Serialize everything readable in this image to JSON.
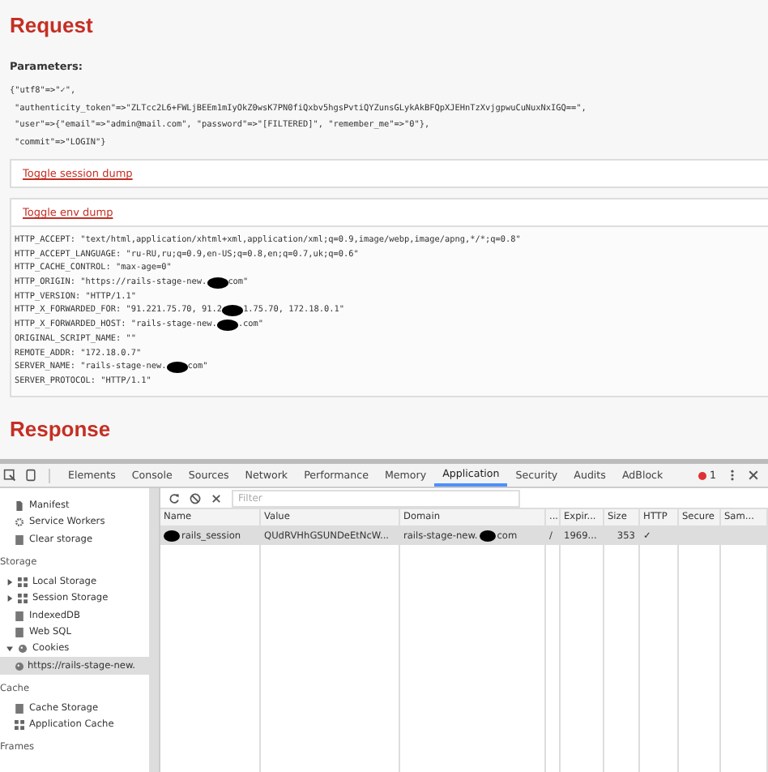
{
  "request": {
    "heading": "Request",
    "parameters_label": "Parameters:",
    "parameter_lines": [
      "{\"utf8\"=>\"✓\",",
      "\"authenticity_token\"=>\"ZLTcc2L6+FWLjBEEm1mIyOkZ0wsK7PN0fiQxbv5hgsPvtiQYZunsGLykAkBFQpXJEHnTzXvjgpwuCuNuxNxIGQ==\",",
      "\"user\"=>{\"email\"=>\"admin@mail.com\", \"password\"=>\"[FILTERED]\", \"remember_me\"=>\"0\"},",
      "\"commit\"=>\"LOGIN\"}"
    ],
    "session_toggle": "Toggle session dump",
    "env_toggle": "Toggle env dump",
    "env_lines": [
      [
        {
          "kind": "text",
          "text": "HTTP_ACCEPT: \"text/html,application/xhtml+xml,application/xml;q=0.9,image/webp,image/apng,*/*;q=0.8\""
        }
      ],
      [
        {
          "kind": "text",
          "text": "HTTP_ACCEPT_LANGUAGE: \"ru-RU,ru;q=0.9,en-US;q=0.8,en;q=0.7,uk;q=0.6\""
        }
      ],
      [
        {
          "kind": "text",
          "text": "HTTP_CACHE_CONTROL: \"max-age=0\""
        }
      ],
      [
        {
          "kind": "text",
          "text": "HTTP_ORIGIN: \"https://rails-stage-new."
        },
        {
          "kind": "redaction"
        },
        {
          "kind": "text",
          "text": "com\""
        }
      ],
      [
        {
          "kind": "text",
          "text": "HTTP_VERSION: \"HTTP/1.1\""
        }
      ],
      [
        {
          "kind": "text",
          "text": "HTTP_X_FORWARDED_FOR: \"91.221.75.70, 91.2"
        },
        {
          "kind": "redaction"
        },
        {
          "kind": "text",
          "text": "1.75.70, 172.18.0.1\""
        }
      ],
      [
        {
          "kind": "text",
          "text": "HTTP_X_FORWARDED_HOST: \"rails-stage-new."
        },
        {
          "kind": "redaction"
        },
        {
          "kind": "text",
          "text": ".com\""
        }
      ],
      [
        {
          "kind": "text",
          "text": "ORIGINAL_SCRIPT_NAME: \"\""
        }
      ],
      [
        {
          "kind": "text",
          "text": "REMOTE_ADDR: \"172.18.0.7\""
        }
      ],
      [
        {
          "kind": "text",
          "text": "SERVER_NAME: \"rails-stage-new."
        },
        {
          "kind": "redaction"
        },
        {
          "kind": "text",
          "text": "com\""
        }
      ],
      [
        {
          "kind": "text",
          "text": "SERVER_PROTOCOL: \"HTTP/1.1\""
        }
      ]
    ]
  },
  "response": {
    "heading": "Response"
  },
  "devtools": {
    "tabs": [
      {
        "label": "Elements",
        "selected": false
      },
      {
        "label": "Console",
        "selected": false
      },
      {
        "label": "Sources",
        "selected": false
      },
      {
        "label": "Network",
        "selected": false
      },
      {
        "label": "Performance",
        "selected": false
      },
      {
        "label": "Memory",
        "selected": false
      },
      {
        "label": "Application",
        "selected": true
      },
      {
        "label": "Security",
        "selected": false
      },
      {
        "label": "Audits",
        "selected": false
      },
      {
        "label": "AdBlock",
        "selected": false
      }
    ],
    "error_count": "1",
    "sidebar": [
      {
        "kind": "item",
        "label": "Manifest"
      },
      {
        "kind": "item",
        "label": "Service Workers"
      },
      {
        "kind": "item",
        "label": "Clear storage"
      },
      {
        "kind": "section",
        "label": "Storage"
      },
      {
        "kind": "item",
        "label": "Local Storage",
        "expanded": false
      },
      {
        "kind": "item",
        "label": "Session Storage",
        "expanded": false
      },
      {
        "kind": "item",
        "label": "IndexedDB"
      },
      {
        "kind": "item",
        "label": "Web SQL"
      },
      {
        "kind": "item",
        "label": "Cookies",
        "expanded": true,
        "children": [
          {
            "kind": "item",
            "label": "https://rails-stage-new.",
            "selected": true
          }
        ]
      },
      {
        "kind": "section",
        "label": "Cache"
      },
      {
        "kind": "item",
        "label": "Cache Storage"
      },
      {
        "kind": "item",
        "label": "Application Cache"
      },
      {
        "kind": "section",
        "label": "Frames"
      }
    ],
    "filter": {
      "placeholder": "Filter"
    },
    "table": {
      "columns": [
        "Name",
        "Value",
        "Domain",
        "...",
        "Expir...",
        "Size",
        "HTTP",
        "Secure",
        "Sam..."
      ],
      "rows": [
        {
          "selected": true,
          "cells": [
            [
              {
                "kind": "redaction"
              },
              {
                "kind": "text",
                "text": "rails_session"
              }
            ],
            [
              {
                "kind": "text",
                "text": "QUdRVHhGSUNDeEtNcW..."
              }
            ],
            [
              {
                "kind": "text",
                "text": "rails-stage-new."
              },
              {
                "kind": "redaction"
              },
              {
                "kind": "text",
                "text": "com"
              }
            ],
            [
              {
                "kind": "text",
                "text": "/"
              }
            ],
            [
              {
                "kind": "text",
                "text": "1969..."
              }
            ],
            [
              {
                "kind": "text",
                "text": "353"
              }
            ],
            [
              {
                "kind": "text",
                "text": "✓"
              }
            ],
            [],
            []
          ]
        }
      ]
    }
  }
}
